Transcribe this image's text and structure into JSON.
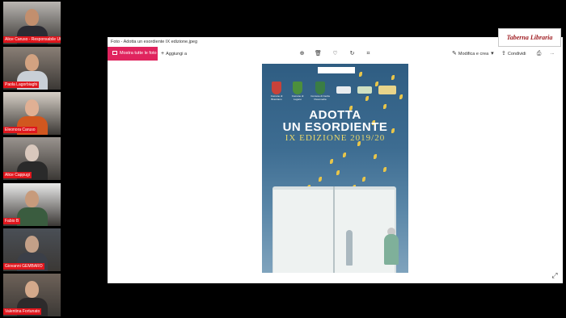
{
  "participants": [
    {
      "name": "Alice Caruso - Responsabile Uffic...",
      "bg": "#b9b6b2",
      "shirt": "#2b2b33",
      "skin": "#c28f6e"
    },
    {
      "name": "Paola Lagorbiaghi",
      "bg": "#8a7f76",
      "shirt": "#c9cfd6",
      "skin": "#d2a281"
    },
    {
      "name": "Eleonora Caruso",
      "bg": "#d6cfc6",
      "shirt": "#d1571f",
      "skin": "#e0b094"
    },
    {
      "name": "Alice Cappugi",
      "bg": "#9a948f",
      "shirt": "#2a2a2a",
      "skin": "#d9c8bd"
    },
    {
      "name": "Fabio B",
      "bg": "#e9e9e9",
      "shirt": "#3a5c3f",
      "skin": "#c79b7c"
    },
    {
      "name": "Giovanni GEMBARO",
      "bg": "#4a4f56",
      "shirt": "#3b3f48",
      "skin": "#c3a088"
    },
    {
      "name": "Valentina Fortunato",
      "bg": "#6e6259",
      "shirt": "#2d2a2b",
      "skin": "#d4a98b"
    }
  ],
  "window": {
    "title": "Foto - Adotta un esordiente IX edizione.jpeg",
    "show_all": "Mostra tutte le foto",
    "add": "Aggiungi a",
    "edit": "Modifica e crea",
    "share": "Condividi",
    "more": "...",
    "icons": [
      "zoom-in-icon",
      "delete-icon",
      "heart-icon",
      "rotate-icon",
      "crop-icon",
      "print-icon",
      "expand-icon"
    ]
  },
  "poster": {
    "brand": "Taberna Libraria",
    "crests": [
      "Comune di Bracciano",
      "Comune di Lugano",
      "Comune di Cerda Pesomedia"
    ],
    "title_line1": "ADOTTA",
    "title_line2": "UN ESORDIENTE",
    "edition": "IX EDIZIONE 2019/20"
  },
  "overlay_logo": {
    "text": "Taberna Libraria"
  },
  "colors": {
    "accent": "#e0245e",
    "name_bar": "#e0161d",
    "brand": "#9e1a1f"
  }
}
